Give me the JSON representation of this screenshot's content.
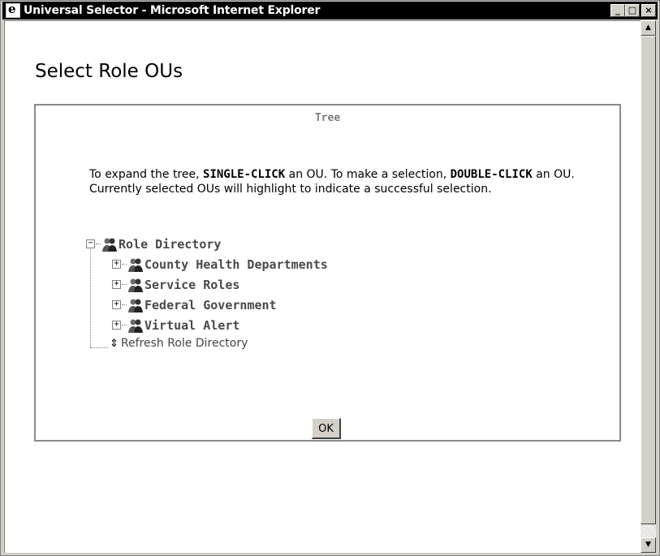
{
  "window": {
    "title": "Universal Selector - Microsoft Internet Explorer",
    "minimize_label": "_",
    "maximize_label": "□",
    "close_label": "×"
  },
  "page": {
    "title": "Select Role OUs"
  },
  "panel": {
    "legend": "Tree",
    "instructions": {
      "part1": "To expand the tree, ",
      "bold1": "SINGLE-CLICK",
      "part2": " an OU. To make a selection, ",
      "bold2": "DOUBLE-CLICK",
      "part3": " an OU. Currently selected OUs will highlight to indicate a successful selection."
    },
    "tree": {
      "root": {
        "label": "Role Directory",
        "expander": "−"
      },
      "children": [
        {
          "label": "County Health Departments",
          "expander": "+"
        },
        {
          "label": "Service Roles",
          "expander": "+"
        },
        {
          "label": "Federal Government",
          "expander": "+"
        },
        {
          "label": "Virtual Alert",
          "expander": "+"
        }
      ],
      "refresh": {
        "label": "Refresh Role Directory",
        "icon": "⇕"
      }
    },
    "ok_label": "OK"
  },
  "scrollbar": {
    "up_icon": "▲",
    "down_icon": "▼"
  }
}
